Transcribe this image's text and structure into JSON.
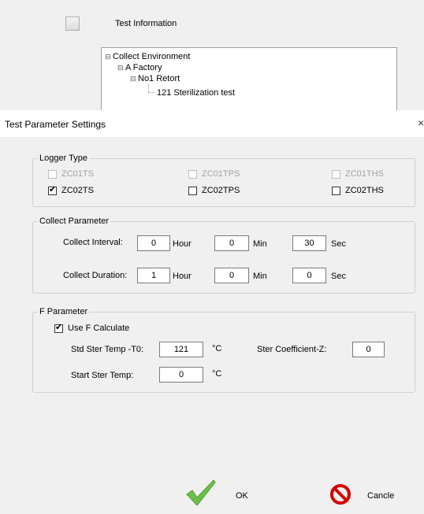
{
  "background_window": {
    "title": "Test Information",
    "tree": [
      {
        "label": "Collect Environment",
        "expander": "⊟"
      },
      {
        "label": "A Factory",
        "expander": "⊟"
      },
      {
        "label": "No1 Retort",
        "expander": "⊟"
      },
      {
        "label": "121 Sterilization test",
        "expander": ""
      }
    ]
  },
  "dialog": {
    "title": "Test Parameter Settings",
    "close_glyph": "×",
    "logger_type": {
      "legend": "Logger Type",
      "options": [
        {
          "label": "ZC01TS",
          "checked": false,
          "enabled": false
        },
        {
          "label": "ZC01TPS",
          "checked": false,
          "enabled": false
        },
        {
          "label": "ZC01THS",
          "checked": false,
          "enabled": false
        },
        {
          "label": "ZC02TS",
          "checked": true,
          "enabled": true
        },
        {
          "label": "ZC02TPS",
          "checked": false,
          "enabled": true
        },
        {
          "label": "ZC02THS",
          "checked": false,
          "enabled": true
        }
      ]
    },
    "collect_parameter": {
      "legend": "Collect Parameter",
      "interval_label": "Collect Interval:",
      "interval_hour": "0",
      "interval_min": "0",
      "interval_sec": "30",
      "duration_label": "Collect Duration:",
      "duration_hour": "1",
      "duration_min": "0",
      "duration_sec": "0",
      "hour_unit": "Hour",
      "min_unit": "Min",
      "sec_unit": "Sec"
    },
    "f_parameter": {
      "legend": "F Parameter",
      "use_f_label": "Use F Calculate",
      "use_f_checked": true,
      "std_temp_label": "Std Ster Temp -T0:",
      "std_temp_value": "121",
      "temp_unit": "°C",
      "ster_coef_label": "Ster Coefficient-Z:",
      "ster_coef_value": "0",
      "start_temp_label": "Start Ster Temp:",
      "start_temp_value": "0"
    },
    "buttons": {
      "ok_label": "OK",
      "cancel_label": "Cancle"
    },
    "colors": {
      "ok_check": "#6cc04a",
      "cancel_red": "#d40000"
    }
  }
}
